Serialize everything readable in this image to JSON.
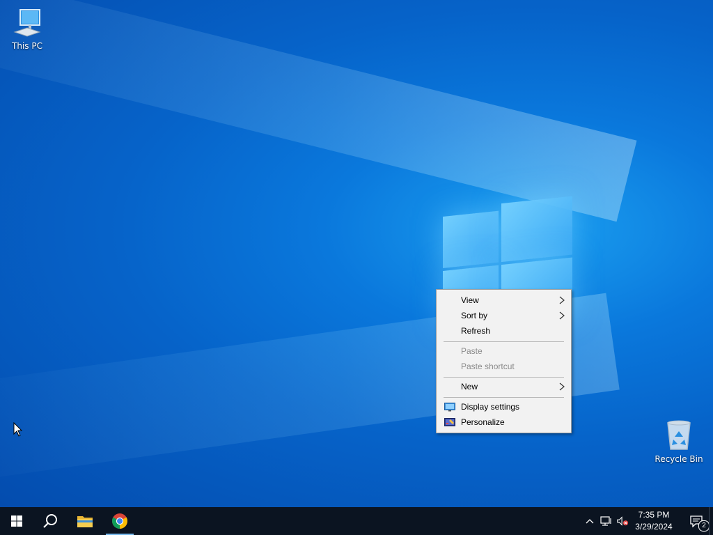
{
  "desktop": {
    "icons": {
      "this_pc": {
        "label": "This PC",
        "icon": "computer-icon"
      },
      "recycle_bin": {
        "label": "Recycle Bin",
        "icon": "recycle-bin-icon"
      }
    }
  },
  "context_menu": {
    "view": "View",
    "sort_by": "Sort by",
    "refresh": "Refresh",
    "paste": "Paste",
    "paste_shortcut": "Paste shortcut",
    "new": "New",
    "display_settings": "Display settings",
    "personalize": "Personalize"
  },
  "taskbar": {
    "pinned": [
      "start-icon",
      "search-icon",
      "file-explorer-icon",
      "chrome-icon"
    ],
    "clock": {
      "time": "7:35 PM",
      "date": "3/29/2024"
    },
    "notifications": {
      "count": "2"
    }
  },
  "colors": {
    "taskbar": "#0b1421",
    "menu_background": "#f2f2f2",
    "disabled_text": "#8a8a8a",
    "chrome_active_underline": "#76b9ed"
  }
}
